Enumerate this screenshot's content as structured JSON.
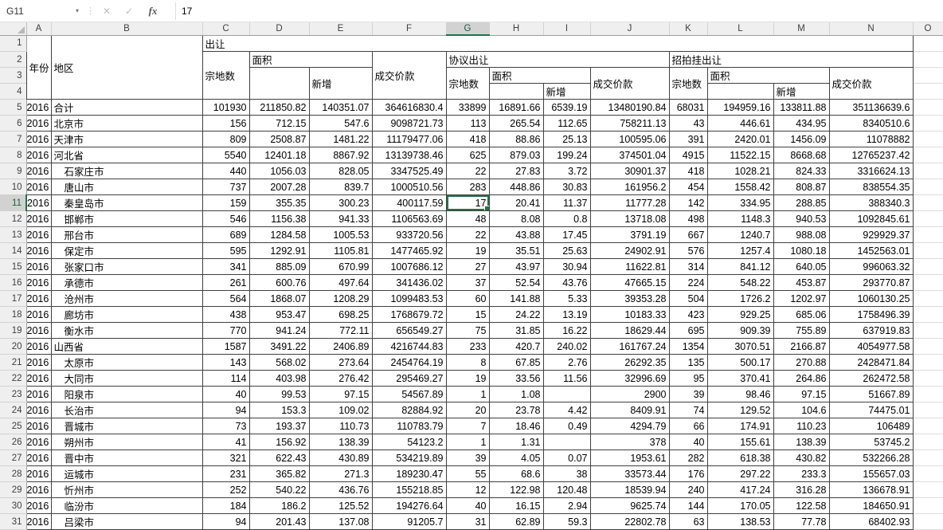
{
  "formula_bar": {
    "name_box": "G11",
    "dropdown_icon": "▾",
    "drag_dots": "⋮",
    "cancel_icon": "✕",
    "accept_icon": "✓",
    "fx_label": "fx",
    "formula": "17"
  },
  "selection": {
    "cell": "G11",
    "row": 11,
    "column": "G",
    "accent_color": "#217346"
  },
  "columns": [
    "A",
    "B",
    "C",
    "D",
    "E",
    "F",
    "G",
    "H",
    "I",
    "J",
    "K",
    "L",
    "M",
    "N",
    "O"
  ],
  "value_columns": [
    "C",
    "D",
    "E",
    "F",
    "G",
    "H",
    "I",
    "J",
    "K",
    "L",
    "M",
    "N"
  ],
  "header": {
    "year": "年份",
    "region": "地区",
    "transfer": "出让",
    "agreement": "协议出让",
    "auction": "招拍挂出让",
    "parcels": "宗地数",
    "area": "面积",
    "new_added": "新增",
    "price": "成交价款"
  },
  "rows": [
    {
      "n": 5,
      "year": "2016",
      "region": "合计",
      "indent": false,
      "values": [
        "101930",
        "211850.82",
        "140351.07",
        "364616830.4",
        "33899",
        "16891.66",
        "6539.19",
        "13480190.84",
        "68031",
        "194959.16",
        "133811.88",
        "351136639.6"
      ]
    },
    {
      "n": 6,
      "year": "2016",
      "region": "北京市",
      "indent": false,
      "values": [
        "156",
        "712.15",
        "547.6",
        "9098721.73",
        "113",
        "265.54",
        "112.65",
        "758211.13",
        "43",
        "446.61",
        "434.95",
        "8340510.6"
      ]
    },
    {
      "n": 7,
      "year": "2016",
      "region": "天津市",
      "indent": false,
      "values": [
        "809",
        "2508.87",
        "1481.22",
        "11179477.06",
        "418",
        "88.86",
        "25.13",
        "100595.06",
        "391",
        "2420.01",
        "1456.09",
        "11078882"
      ]
    },
    {
      "n": 8,
      "year": "2016",
      "region": "河北省",
      "indent": false,
      "values": [
        "5540",
        "12401.18",
        "8867.92",
        "13139738.46",
        "625",
        "879.03",
        "199.24",
        "374501.04",
        "4915",
        "11522.15",
        "8668.68",
        "12765237.42"
      ]
    },
    {
      "n": 9,
      "year": "2016",
      "region": "石家庄市",
      "indent": true,
      "values": [
        "440",
        "1056.03",
        "828.05",
        "3347525.49",
        "22",
        "27.83",
        "3.72",
        "30901.37",
        "418",
        "1028.21",
        "824.33",
        "3316624.13"
      ]
    },
    {
      "n": 10,
      "year": "2016",
      "region": "唐山市",
      "indent": true,
      "values": [
        "737",
        "2007.28",
        "839.7",
        "1000510.56",
        "283",
        "448.86",
        "30.83",
        "161956.2",
        "454",
        "1558.42",
        "808.87",
        "838554.35"
      ]
    },
    {
      "n": 11,
      "year": "2016",
      "region": "秦皇岛市",
      "indent": true,
      "values": [
        "159",
        "355.35",
        "300.23",
        "400117.59",
        "17",
        "20.41",
        "11.37",
        "11777.28",
        "142",
        "334.95",
        "288.85",
        "388340.3"
      ]
    },
    {
      "n": 12,
      "year": "2016",
      "region": "邯郸市",
      "indent": true,
      "values": [
        "546",
        "1156.38",
        "941.33",
        "1106563.69",
        "48",
        "8.08",
        "0.8",
        "13718.08",
        "498",
        "1148.3",
        "940.53",
        "1092845.61"
      ]
    },
    {
      "n": 13,
      "year": "2016",
      "region": "邢台市",
      "indent": true,
      "values": [
        "689",
        "1284.58",
        "1005.53",
        "933720.56",
        "22",
        "43.88",
        "17.45",
        "3791.19",
        "667",
        "1240.7",
        "988.08",
        "929929.37"
      ]
    },
    {
      "n": 14,
      "year": "2016",
      "region": "保定市",
      "indent": true,
      "values": [
        "595",
        "1292.91",
        "1105.81",
        "1477465.92",
        "19",
        "35.51",
        "25.63",
        "24902.91",
        "576",
        "1257.4",
        "1080.18",
        "1452563.01"
      ]
    },
    {
      "n": 15,
      "year": "2016",
      "region": "张家口市",
      "indent": true,
      "values": [
        "341",
        "885.09",
        "670.99",
        "1007686.12",
        "27",
        "43.97",
        "30.94",
        "11622.81",
        "314",
        "841.12",
        "640.05",
        "996063.32"
      ]
    },
    {
      "n": 16,
      "year": "2016",
      "region": "承德市",
      "indent": true,
      "values": [
        "261",
        "600.76",
        "497.64",
        "341436.02",
        "37",
        "52.54",
        "43.76",
        "47665.15",
        "224",
        "548.22",
        "453.87",
        "293770.87"
      ]
    },
    {
      "n": 17,
      "year": "2016",
      "region": "沧州市",
      "indent": true,
      "values": [
        "564",
        "1868.07",
        "1208.29",
        "1099483.53",
        "60",
        "141.88",
        "5.33",
        "39353.28",
        "504",
        "1726.2",
        "1202.97",
        "1060130.25"
      ]
    },
    {
      "n": 18,
      "year": "2016",
      "region": "廊坊市",
      "indent": true,
      "values": [
        "438",
        "953.47",
        "698.25",
        "1768679.72",
        "15",
        "24.22",
        "13.19",
        "10183.33",
        "423",
        "929.25",
        "685.06",
        "1758496.39"
      ]
    },
    {
      "n": 19,
      "year": "2016",
      "region": "衡水市",
      "indent": true,
      "values": [
        "770",
        "941.24",
        "772.11",
        "656549.27",
        "75",
        "31.85",
        "16.22",
        "18629.44",
        "695",
        "909.39",
        "755.89",
        "637919.83"
      ]
    },
    {
      "n": 20,
      "year": "2016",
      "region": "山西省",
      "indent": false,
      "values": [
        "1587",
        "3491.22",
        "2406.89",
        "4216744.83",
        "233",
        "420.7",
        "240.02",
        "161767.24",
        "1354",
        "3070.51",
        "2166.87",
        "4054977.58"
      ]
    },
    {
      "n": 21,
      "year": "2016",
      "region": "太原市",
      "indent": true,
      "values": [
        "143",
        "568.02",
        "273.64",
        "2454764.19",
        "8",
        "67.85",
        "2.76",
        "26292.35",
        "135",
        "500.17",
        "270.88",
        "2428471.84"
      ]
    },
    {
      "n": 22,
      "year": "2016",
      "region": "大同市",
      "indent": true,
      "values": [
        "114",
        "403.98",
        "276.42",
        "295469.27",
        "19",
        "33.56",
        "11.56",
        "32996.69",
        "95",
        "370.41",
        "264.86",
        "262472.58"
      ]
    },
    {
      "n": 23,
      "year": "2016",
      "region": "阳泉市",
      "indent": true,
      "values": [
        "40",
        "99.53",
        "97.15",
        "54567.89",
        "1",
        "1.08",
        "",
        "2900",
        "39",
        "98.46",
        "97.15",
        "51667.89"
      ]
    },
    {
      "n": 24,
      "year": "2016",
      "region": "长治市",
      "indent": true,
      "values": [
        "94",
        "153.3",
        "109.02",
        "82884.92",
        "20",
        "23.78",
        "4.42",
        "8409.91",
        "74",
        "129.52",
        "104.6",
        "74475.01"
      ]
    },
    {
      "n": 25,
      "year": "2016",
      "region": "晋城市",
      "indent": true,
      "values": [
        "73",
        "193.37",
        "110.73",
        "110783.79",
        "7",
        "18.46",
        "0.49",
        "4294.79",
        "66",
        "174.91",
        "110.23",
        "106489"
      ]
    },
    {
      "n": 26,
      "year": "2016",
      "region": "朔州市",
      "indent": true,
      "values": [
        "41",
        "156.92",
        "138.39",
        "54123.2",
        "1",
        "1.31",
        "",
        "378",
        "40",
        "155.61",
        "138.39",
        "53745.2"
      ]
    },
    {
      "n": 27,
      "year": "2016",
      "region": "晋中市",
      "indent": true,
      "values": [
        "321",
        "622.43",
        "430.89",
        "534219.89",
        "39",
        "4.05",
        "0.07",
        "1953.61",
        "282",
        "618.38",
        "430.82",
        "532266.28"
      ]
    },
    {
      "n": 28,
      "year": "2016",
      "region": "运城市",
      "indent": true,
      "values": [
        "231",
        "365.82",
        "271.3",
        "189230.47",
        "55",
        "68.6",
        "38",
        "33573.44",
        "176",
        "297.22",
        "233.3",
        "155657.03"
      ]
    },
    {
      "n": 29,
      "year": "2016",
      "region": "忻州市",
      "indent": true,
      "values": [
        "252",
        "540.22",
        "436.76",
        "155218.85",
        "12",
        "122.98",
        "120.48",
        "18539.94",
        "240",
        "417.24",
        "316.28",
        "136678.91"
      ]
    },
    {
      "n": 30,
      "year": "2016",
      "region": "临汾市",
      "indent": true,
      "values": [
        "184",
        "186.2",
        "125.52",
        "194276.64",
        "40",
        "16.15",
        "2.94",
        "9625.74",
        "144",
        "170.05",
        "122.58",
        "184650.91"
      ]
    },
    {
      "n": 31,
      "year": "2016",
      "region": "吕梁市",
      "indent": true,
      "values": [
        "94",
        "201.43",
        "137.08",
        "91205.7",
        "31",
        "62.89",
        "59.3",
        "22802.78",
        "63",
        "138.53",
        "77.78",
        "68402.93"
      ]
    }
  ]
}
